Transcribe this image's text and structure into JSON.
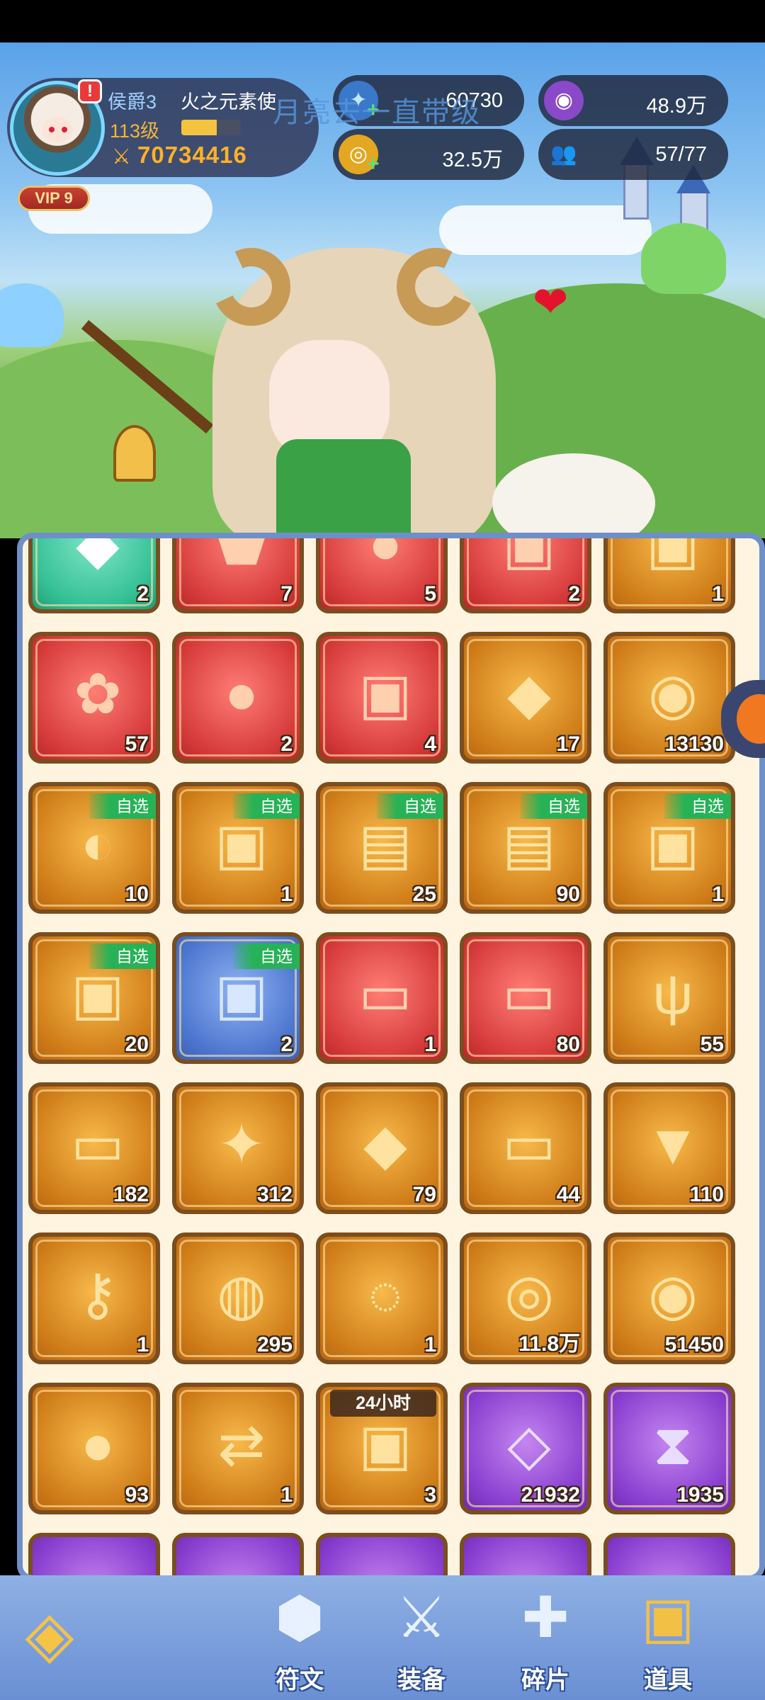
{
  "player": {
    "rank": "侯爵3",
    "title": "火之元素使",
    "level": "113级",
    "level_progress": 0.6,
    "power": "70734416",
    "vip": "VIP 9",
    "alert": "!"
  },
  "overlay_text": "月亮去一直带级",
  "resources": [
    {
      "icon": "star-gem-icon",
      "value": "60730"
    },
    {
      "icon": "purple-coin-icon",
      "value": "48.9万"
    },
    {
      "icon": "gold-coin-icon",
      "value": "32.5万"
    },
    {
      "icon": "friends-icon",
      "value": "57/77"
    }
  ],
  "inventory": {
    "select_label": "自选",
    "timer_label": "24小时",
    "rows": [
      [
        {
          "color": "green",
          "icon": "rainbow-crystal-icon",
          "count": "2"
        },
        {
          "color": "red",
          "icon": "red-gem-icon",
          "count": "7"
        },
        {
          "color": "red",
          "icon": "gift-egg-icon",
          "count": "5"
        },
        {
          "color": "red",
          "icon": "treasure-chest-icon",
          "count": "2"
        },
        {
          "color": "gold",
          "icon": "treasure-chest-icon",
          "count": "1"
        }
      ],
      [
        {
          "color": "red",
          "icon": "crystal-flower-icon",
          "count": "57"
        },
        {
          "color": "red",
          "icon": "fire-egg-icon",
          "count": "2"
        },
        {
          "color": "red",
          "icon": "mystery-chest-icon",
          "count": "4"
        },
        {
          "color": "gold",
          "icon": "gold-crystal-icon",
          "count": "17"
        },
        {
          "color": "gold",
          "icon": "silver-coin-icon",
          "count": "13130"
        }
      ],
      [
        {
          "color": "gold",
          "icon": "pet-egg-box-icon",
          "count": "10",
          "select": true
        },
        {
          "color": "gold",
          "icon": "gem-chest-icon",
          "count": "1",
          "select": true
        },
        {
          "color": "gold",
          "icon": "gift-box-icon",
          "count": "25",
          "select": true
        },
        {
          "color": "gold",
          "icon": "gift-box-icon",
          "count": "90",
          "select": true
        },
        {
          "color": "gold",
          "icon": "treasure-chest-icon",
          "count": "1",
          "select": true
        }
      ],
      [
        {
          "color": "gold",
          "icon": "treasure-chest-icon",
          "count": "20",
          "select": true
        },
        {
          "color": "blue",
          "icon": "blue-orb-chest-icon",
          "count": "2",
          "select": true
        },
        {
          "color": "red",
          "icon": "blue-ticket-icon",
          "count": "1"
        },
        {
          "color": "red",
          "icon": "sun-ticket-icon",
          "count": "80"
        },
        {
          "color": "gold",
          "icon": "coral-icon",
          "count": "55"
        }
      ],
      [
        {
          "color": "gold",
          "icon": "scroll-ticket-icon",
          "count": "182"
        },
        {
          "color": "gold",
          "icon": "star-crystal-icon",
          "count": "312"
        },
        {
          "color": "gold",
          "icon": "green-crystal-icon",
          "count": "79"
        },
        {
          "color": "gold",
          "icon": "heart-ticket-icon",
          "count": "44"
        },
        {
          "color": "gold",
          "icon": "rainbow-drill-icon",
          "count": "110"
        }
      ],
      [
        {
          "color": "gold",
          "icon": "gold-key-icon",
          "count": "1"
        },
        {
          "color": "gold",
          "icon": "lightning-potion-icon",
          "count": "295"
        },
        {
          "color": "gold",
          "icon": "swirl-stone-icon",
          "count": "1"
        },
        {
          "color": "gold",
          "icon": "gold-medal-icon",
          "count": "11.8万"
        },
        {
          "color": "gold",
          "icon": "purple-coin-icon",
          "count": "51450"
        }
      ],
      [
        {
          "color": "gold",
          "icon": "dragon-egg-icon",
          "count": "93"
        },
        {
          "color": "gold",
          "icon": "swap-potion-icon",
          "count": "1"
        },
        {
          "color": "gold",
          "icon": "coin-chest-icon",
          "count": "3",
          "timer": true
        },
        {
          "color": "purple",
          "icon": "diamond-icon",
          "count": "21932"
        },
        {
          "color": "purple",
          "icon": "hourglass-icon",
          "count": "1935"
        }
      ]
    ]
  },
  "nav": [
    {
      "label": "符文",
      "icon": "rune-icon"
    },
    {
      "label": "装备",
      "icon": "crossed-swords-icon"
    },
    {
      "label": "碎片",
      "icon": "puzzle-piece-icon"
    },
    {
      "label": "道具",
      "icon": "treasure-chest-icon",
      "active": true
    }
  ],
  "colors": {
    "gold_slot": "#cf7d19",
    "red_slot": "#d73c3c",
    "purple_slot": "#8a3fd0",
    "blue_slot": "#4d76cf",
    "green_slot": "#35c096",
    "select_tag": "#27b257",
    "power": "#ffb12a"
  }
}
